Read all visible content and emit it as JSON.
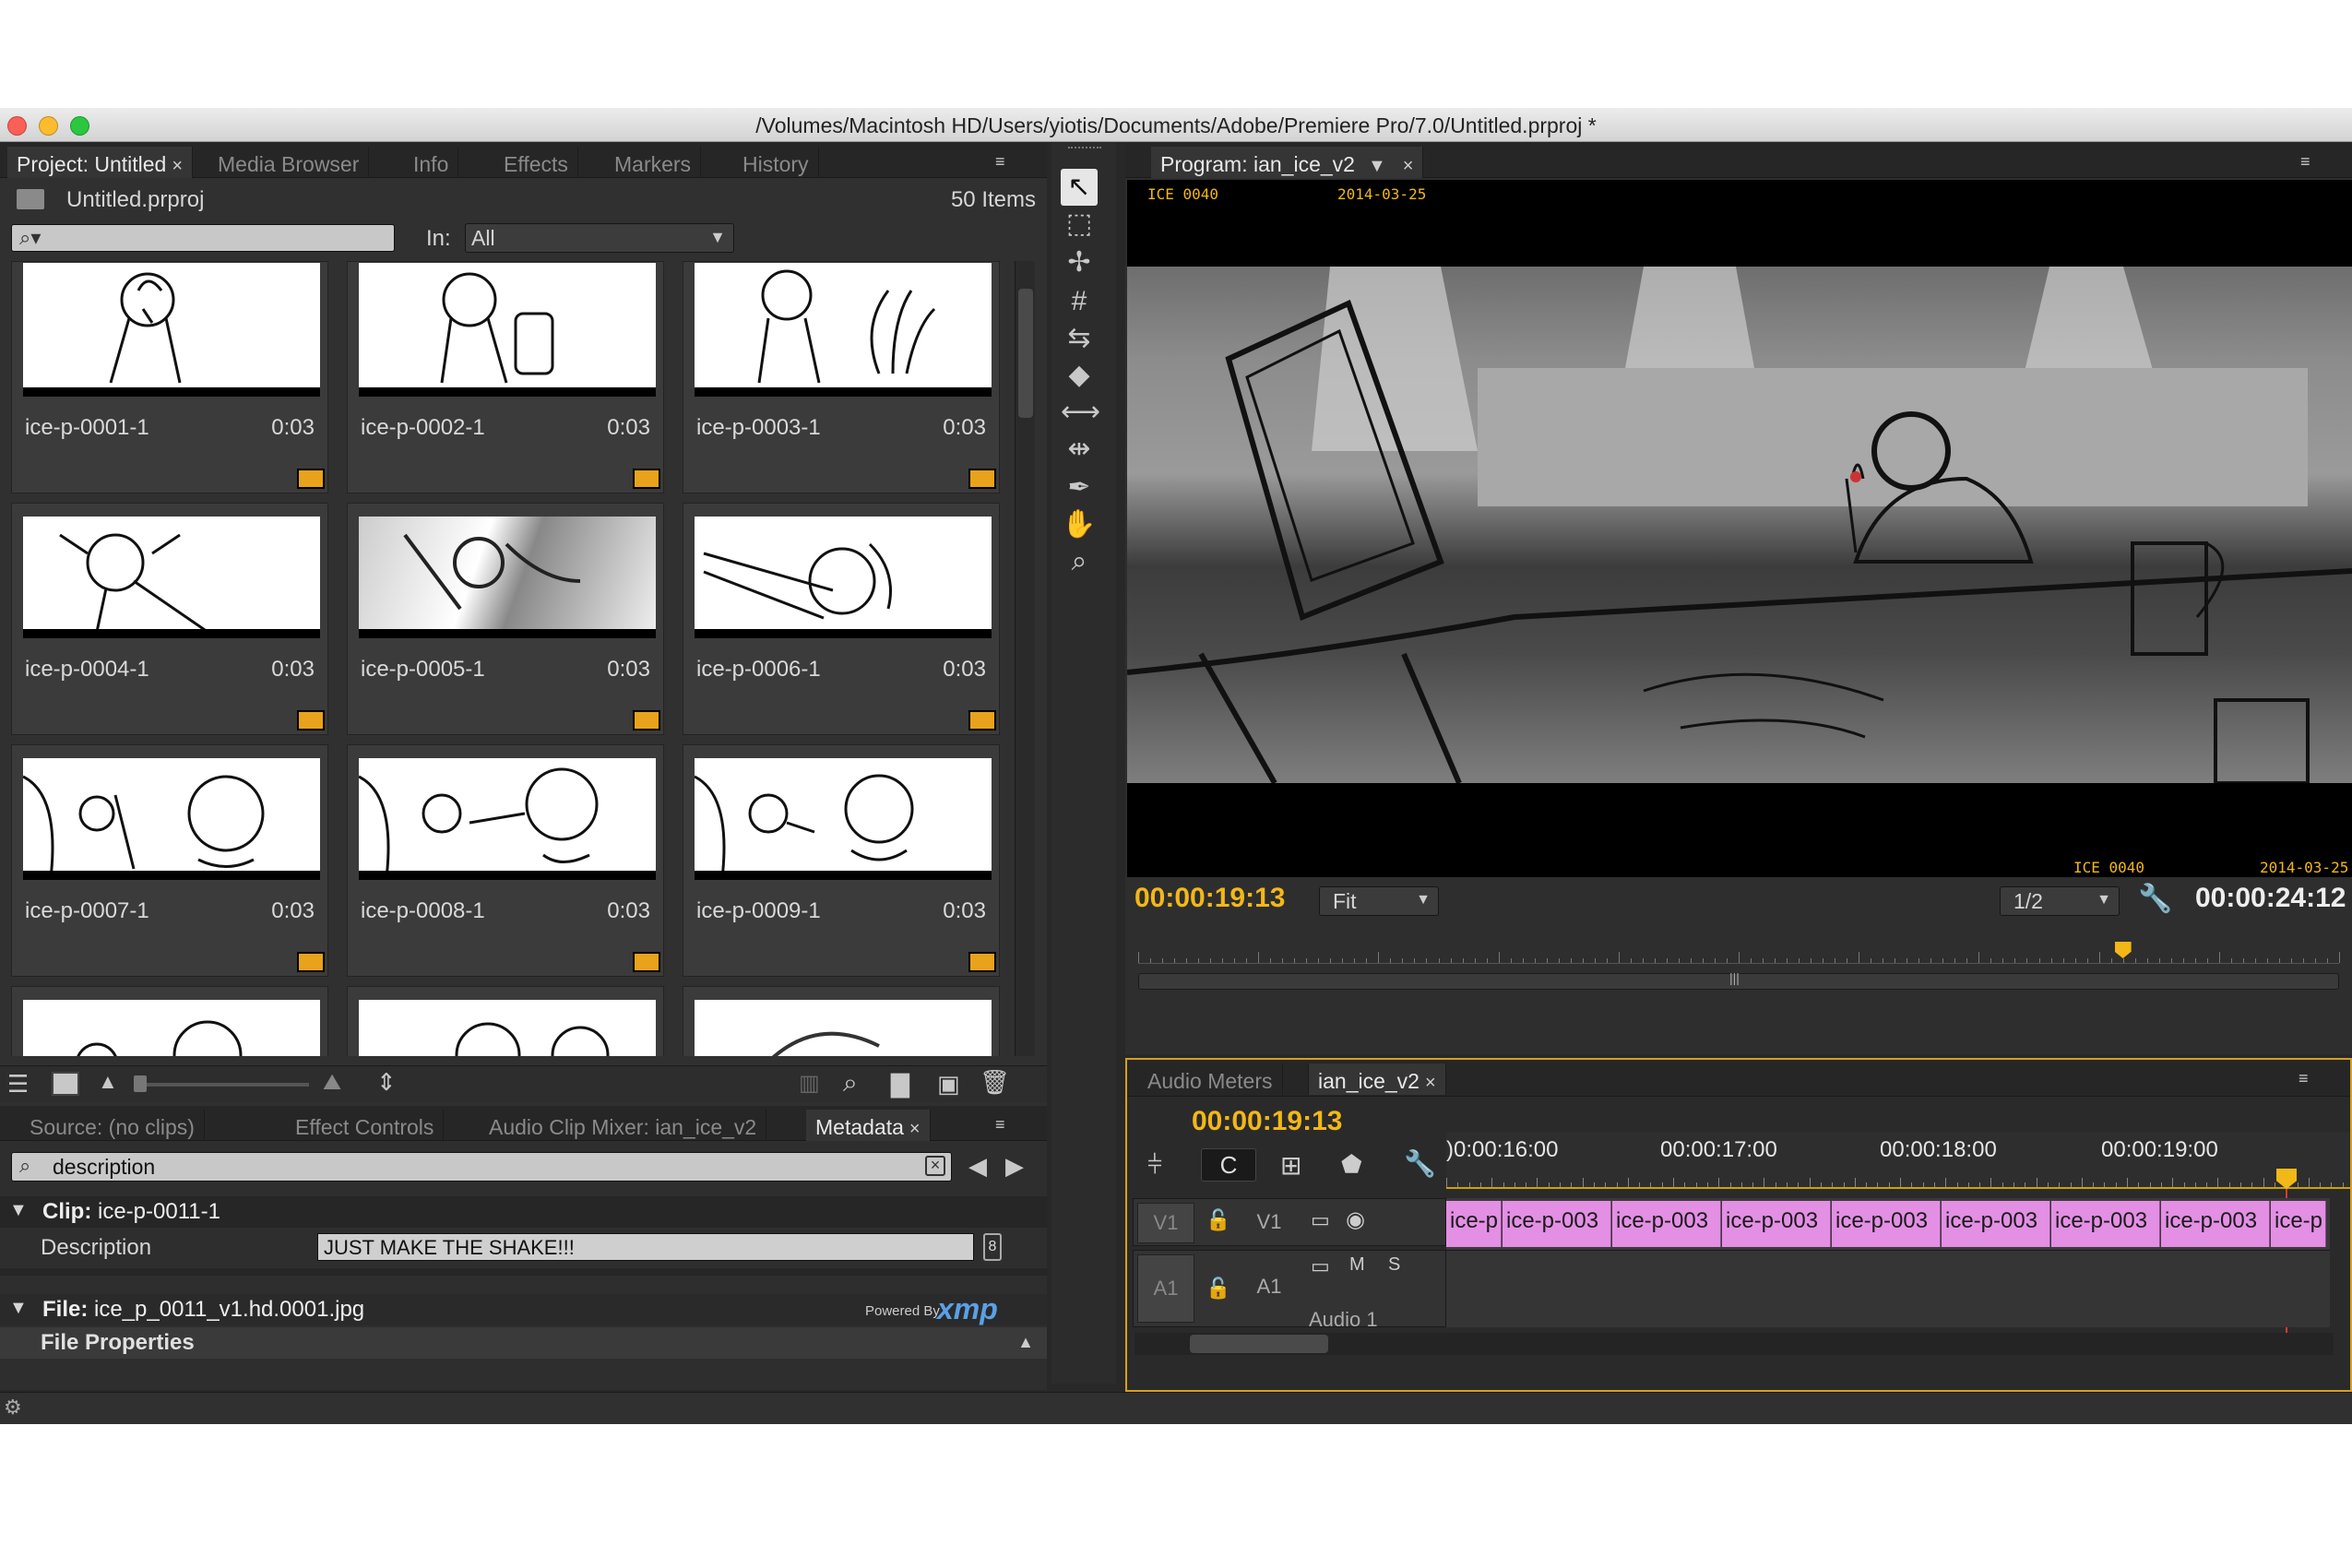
{
  "window": {
    "title": "/Volumes/Macintosh HD/Users/yiotis/Documents/Adobe/Premiere Pro/7.0/Untitled.prproj *"
  },
  "project_panel": {
    "tabs": [
      {
        "label": "Project: Untitled",
        "active": true
      },
      {
        "label": "Media Browser"
      },
      {
        "label": "Info"
      },
      {
        "label": "Effects"
      },
      {
        "label": "Markers"
      },
      {
        "label": "History"
      }
    ],
    "file_name": "Untitled.prproj",
    "item_count": "50 Items",
    "in_label": "In:",
    "in_value": "All",
    "clips": [
      {
        "name": "ice-p-0001-1",
        "duration": "0:03"
      },
      {
        "name": "ice-p-0002-1",
        "duration": "0:03"
      },
      {
        "name": "ice-p-0003-1",
        "duration": "0:03"
      },
      {
        "name": "ice-p-0004-1",
        "duration": "0:03"
      },
      {
        "name": "ice-p-0005-1",
        "duration": "0:03"
      },
      {
        "name": "ice-p-0006-1",
        "duration": "0:03"
      },
      {
        "name": "ice-p-0007-1",
        "duration": "0:03"
      },
      {
        "name": "ice-p-0008-1",
        "duration": "0:03"
      },
      {
        "name": "ice-p-0009-1",
        "duration": "0:03"
      }
    ]
  },
  "lower_left": {
    "tabs": [
      {
        "label": "Source: (no clips)"
      },
      {
        "label": "Effect Controls"
      },
      {
        "label": "Audio Clip Mixer: ian_ice_v2"
      },
      {
        "label": "Metadata",
        "active": true
      }
    ],
    "search_value": "description",
    "clip_label": "Clip:",
    "clip_name": "ice-p-0011-1",
    "description_label": "Description",
    "description_value": "JUST MAKE THE SHAKE!!!",
    "file_label": "File:",
    "file_name": "ice_p_0011_v1.hd.0001.jpg",
    "powered_by": "Powered By",
    "xmp": "xmp",
    "file_properties": "File Properties"
  },
  "program_monitor": {
    "tab": "Program: ian_ice_v2",
    "overlay_top_left": "ICE  0040",
    "overlay_top_date": "2014-03-25",
    "overlay_bottom_left": "ICE  0040",
    "overlay_bottom_date": "2014-03-25",
    "current_time": "00:00:19:13",
    "zoom": "Fit",
    "resolution": "1/2",
    "duration": "00:00:24:12",
    "playhead_fraction": 0.82
  },
  "timeline": {
    "tabs": [
      {
        "label": "Audio Meters"
      },
      {
        "label": "ian_ice_v2",
        "active": true
      }
    ],
    "current_time": "00:00:19:13",
    "ruler_labels": [
      "00:00:16:00",
      "00:00:17:00",
      "00:00:18:00",
      "00:00:19:00"
    ],
    "ruler_first": ")0:00:16:00",
    "video_track": {
      "target": "V1",
      "name": "V1"
    },
    "audio_track": {
      "target": "A1",
      "name": "A1",
      "mute": "M",
      "solo": "S",
      "label": "Audio 1"
    },
    "clips": [
      "ice-p",
      "ice-p-003",
      "ice-p-003",
      "ice-p-003",
      "ice-p-003",
      "ice-p-003",
      "ice-p-003",
      "ice-p-003",
      "ice-p"
    ]
  },
  "icons": {
    "selection": "arrow-icon",
    "hand": "hand-icon",
    "zoom": "magnifier-icon",
    "camera": "camera-icon",
    "wrench": "wrench-icon",
    "trash": "trash-icon"
  },
  "colors": {
    "clip": "#e38fe4",
    "timecode": "#f2b817",
    "background": "#282828"
  }
}
